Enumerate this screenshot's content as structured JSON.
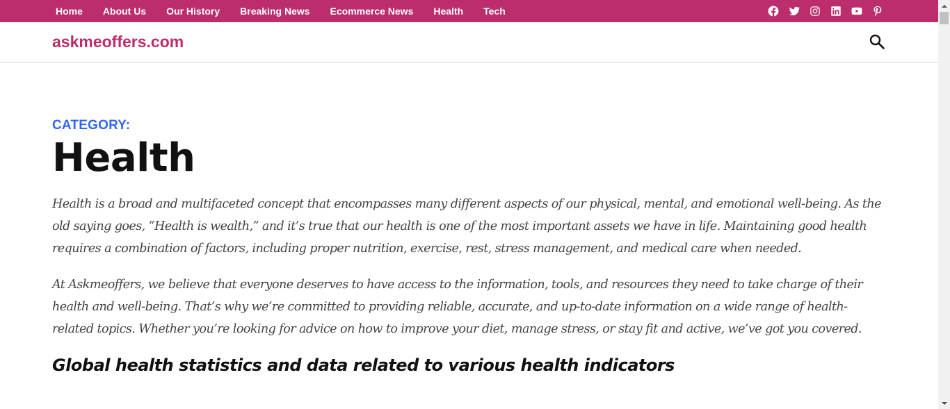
{
  "topbar": {
    "nav": [
      "Home",
      "About Us",
      "Our History",
      "Breaking News",
      "Ecommerce News",
      "Health",
      "Tech"
    ],
    "social_icons": [
      "facebook-icon",
      "twitter-icon",
      "instagram-icon",
      "linkedin-icon",
      "youtube-icon",
      "pinterest-icon"
    ],
    "bg_color": "#bb2d6c"
  },
  "header": {
    "site_title": "askmeoffers.com",
    "search_icon": "search-icon"
  },
  "main": {
    "category_label": "CATEGORY:",
    "title": "Health",
    "paragraphs": [
      "Health is a broad and multifaceted concept that encompasses many different aspects of our physical, mental, and emotional well-being. As the old saying goes, “Health is wealth,” and it’s true that our health is one of the most important assets we have in life. Maintaining good health requires a combination of factors, including proper nutrition, exercise, rest, stress management, and medical care when needed.",
      "At Askmeoffers, we believe that everyone deserves to have access to the information, tools, and resources they need to take charge of their health and well-being. That’s why we’re committed to providing reliable, accurate, and up-to-date information on a wide range of health-related topics. Whether you’re looking for advice on how to improve your diet, manage stress, or stay fit and active, we’ve got you covered."
    ],
    "subheading": "Global health statistics and data related to various health indicators"
  },
  "colors": {
    "brand": "#bb2d6c",
    "category": "#3366ee",
    "body_text": "#444444"
  }
}
